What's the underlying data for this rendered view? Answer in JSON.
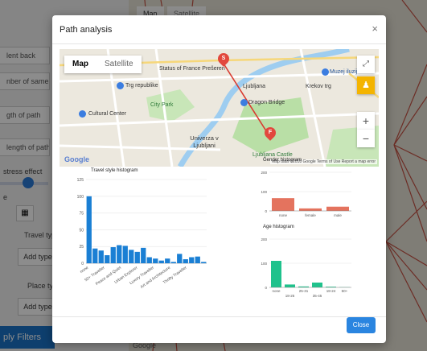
{
  "background": {
    "sidebar_fields": [
      {
        "label": "lent back",
        "top": 0
      },
      {
        "label": "nber of same p",
        "top": 0
      },
      {
        "label": "gth of path",
        "top": 0
      },
      {
        "label": "length of path",
        "top": 0
      }
    ],
    "labels": {
      "stress_effect": "stress effect",
      "e": "e",
      "travel_type": "Travel typ",
      "place_type": "Place typ"
    },
    "add_type_1": "Add type",
    "add_type_2": "Add type",
    "apply_filters": "ply Filters",
    "map_tab": "Map",
    "satellite_tab": "Satellite",
    "google": "Google"
  },
  "modal": {
    "title": "Path analysis",
    "close_icon": "×",
    "close_button": "Close"
  },
  "map": {
    "type_map": "Map",
    "type_satellite": "Satellite",
    "google": "Google",
    "footer": "Map data ©2018 Google   Terms of Use   Report a map error",
    "labels": [
      {
        "text": "Status of France Prešeren"
      },
      {
        "text": "Trg republike"
      },
      {
        "text": "City Park"
      },
      {
        "text": "Cultural Center"
      },
      {
        "text": "Univerza v Ljubljani"
      },
      {
        "text": "Ljubljana Castle"
      },
      {
        "text": "Dragon Bridge"
      },
      {
        "text": "Muzej iluzij"
      },
      {
        "text": "Krekov trg"
      },
      {
        "text": "Ljubljana"
      }
    ],
    "marker_start": "S",
    "marker_end": "F"
  },
  "chart_data": [
    {
      "type": "bar",
      "title": "Travel style histogram",
      "categories": [
        "none",
        "50+ Traveller",
        "Peace and Quiet",
        "Urban Explorer",
        "Luxury Traveller",
        "Art and Architecture",
        "Thrifty Traveller"
      ],
      "values": [
        100,
        22,
        19,
        12,
        24,
        27,
        26,
        20,
        17,
        23,
        9,
        7,
        4,
        7,
        2,
        14,
        6,
        9,
        10,
        2
      ],
      "ylim": [
        0,
        125
      ],
      "yticks": [
        0,
        25,
        50,
        75,
        100,
        125
      ],
      "color": "#1a7fd4"
    },
    {
      "type": "bar",
      "title": "Gender histogram",
      "categories": [
        "none",
        "female",
        "male"
      ],
      "values": [
        66,
        13,
        22
      ],
      "ylim": [
        0,
        200
      ],
      "yticks": [
        0,
        100,
        200
      ],
      "color": "#e4735e"
    },
    {
      "type": "bar",
      "title": "Age histogram",
      "categories": [
        "none",
        "18-25",
        "25-31",
        "35-45",
        "18-24",
        "50+"
      ],
      "x_labels_top": [
        "none",
        "25-31",
        "18-24",
        "50+"
      ],
      "x_labels_bottom": [
        "18-25",
        "35-45"
      ],
      "values": [
        110,
        12,
        4,
        20,
        3,
        1
      ],
      "ylim": [
        0,
        200
      ],
      "yticks": [
        0,
        100,
        200
      ],
      "color": "#1fc28c"
    }
  ],
  "colors": {
    "primary": "#2a85e0",
    "marker": "#e2483d",
    "route": "#d93a2f"
  }
}
